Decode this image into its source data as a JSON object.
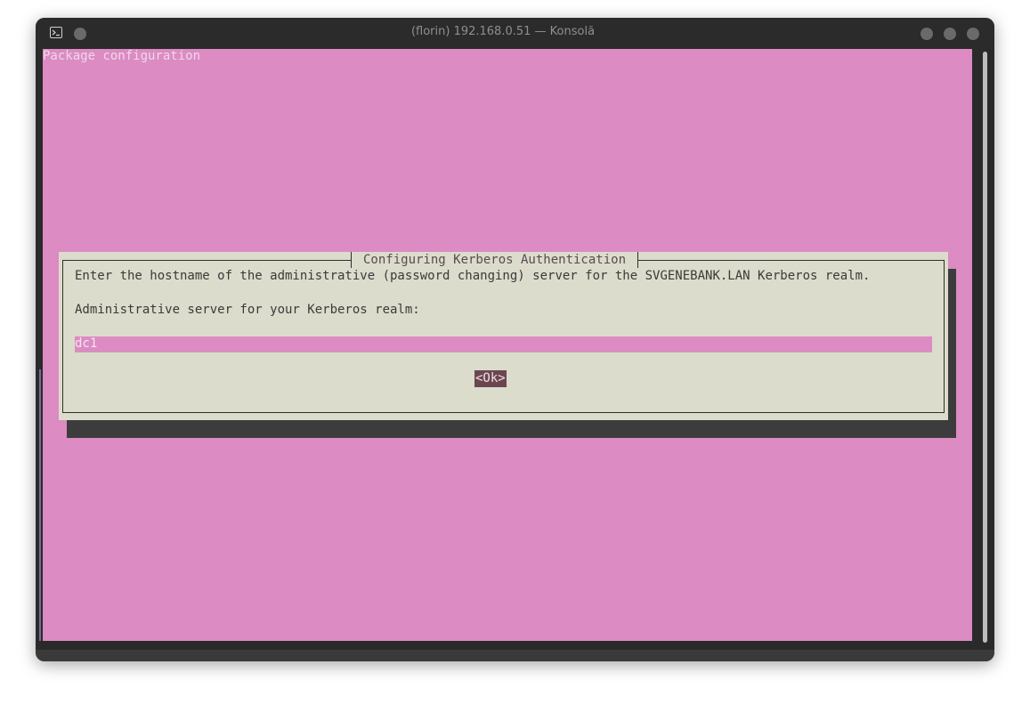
{
  "window": {
    "title": "(florin) 192.168.0.51 — Konsolă"
  },
  "terminal": {
    "header": "Package configuration"
  },
  "dialog": {
    "title": "Configuring Kerberos Authentication",
    "message": "Enter the hostname of the administrative (password changing) server for the SVGENEBANK.LAN Kerberos realm.",
    "prompt": "Administrative server for your Kerberos realm:",
    "input_value": "dc1",
    "ok_label": "<Ok>"
  },
  "colors": {
    "terminal_background": "#dc8bc3",
    "dialog_background": "#dcdccc",
    "button_background": "#6b4650"
  }
}
